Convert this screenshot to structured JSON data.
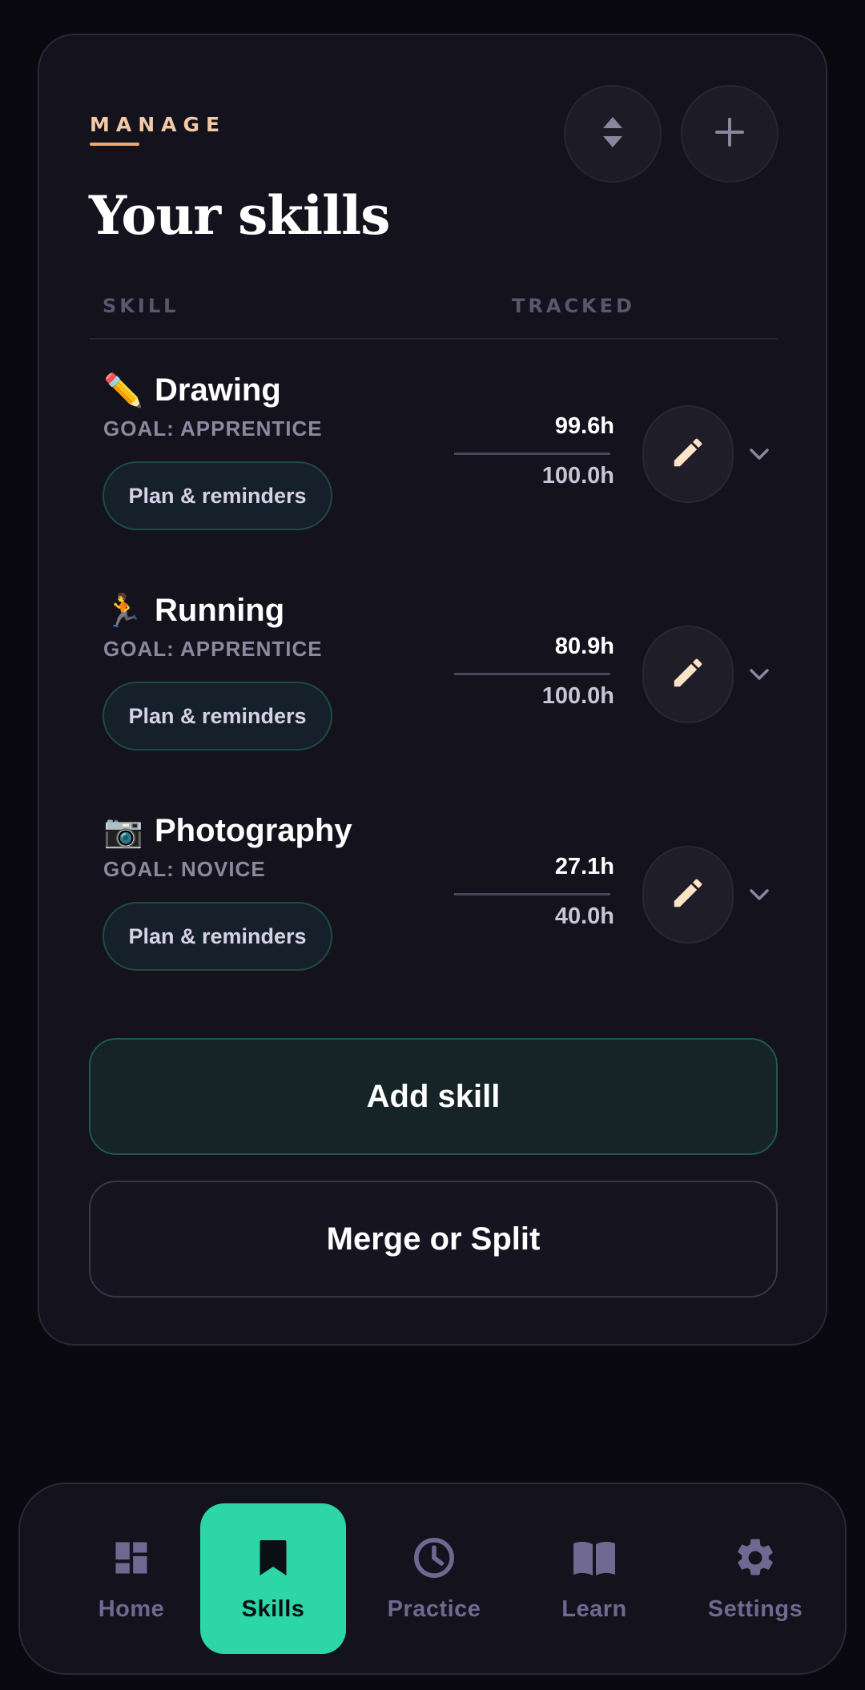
{
  "header": {
    "eyebrow": "MANAGE",
    "title": "Your skills",
    "reorder_icon": "sort-icon",
    "add_icon": "plus-icon"
  },
  "table": {
    "col_skill": "SKILL",
    "col_tracked": "TRACKED"
  },
  "skills": [
    {
      "emoji": "✏️",
      "name": "Drawing",
      "goal": "GOAL: APPRENTICE",
      "plan_label": "Plan & reminders",
      "tracked": "99.6h",
      "target": "100.0h"
    },
    {
      "emoji": "🏃",
      "name": "Running",
      "goal": "GOAL: APPRENTICE",
      "plan_label": "Plan & reminders",
      "tracked": "80.9h",
      "target": "100.0h"
    },
    {
      "emoji": "📷",
      "name": "Photography",
      "goal": "GOAL: NOVICE",
      "plan_label": "Plan & reminders",
      "tracked": "27.1h",
      "target": "40.0h"
    }
  ],
  "actions": {
    "add_skill": "Add skill",
    "merge_split": "Merge or Split"
  },
  "nav": {
    "items": [
      {
        "label": "Home",
        "icon": "dashboard-icon"
      },
      {
        "label": "Skills",
        "icon": "bookmark-icon",
        "active": true
      },
      {
        "label": "Practice",
        "icon": "clock-icon"
      },
      {
        "label": "Learn",
        "icon": "book-icon"
      },
      {
        "label": "Settings",
        "icon": "gear-icon"
      }
    ]
  },
  "colors": {
    "accent": "#2dd6a7",
    "eyebrow": "#f3c9a6",
    "pencil": "#fde3c8",
    "nav_inactive": "#6f6890",
    "background": "#0a0910",
    "card": "#14121c"
  }
}
